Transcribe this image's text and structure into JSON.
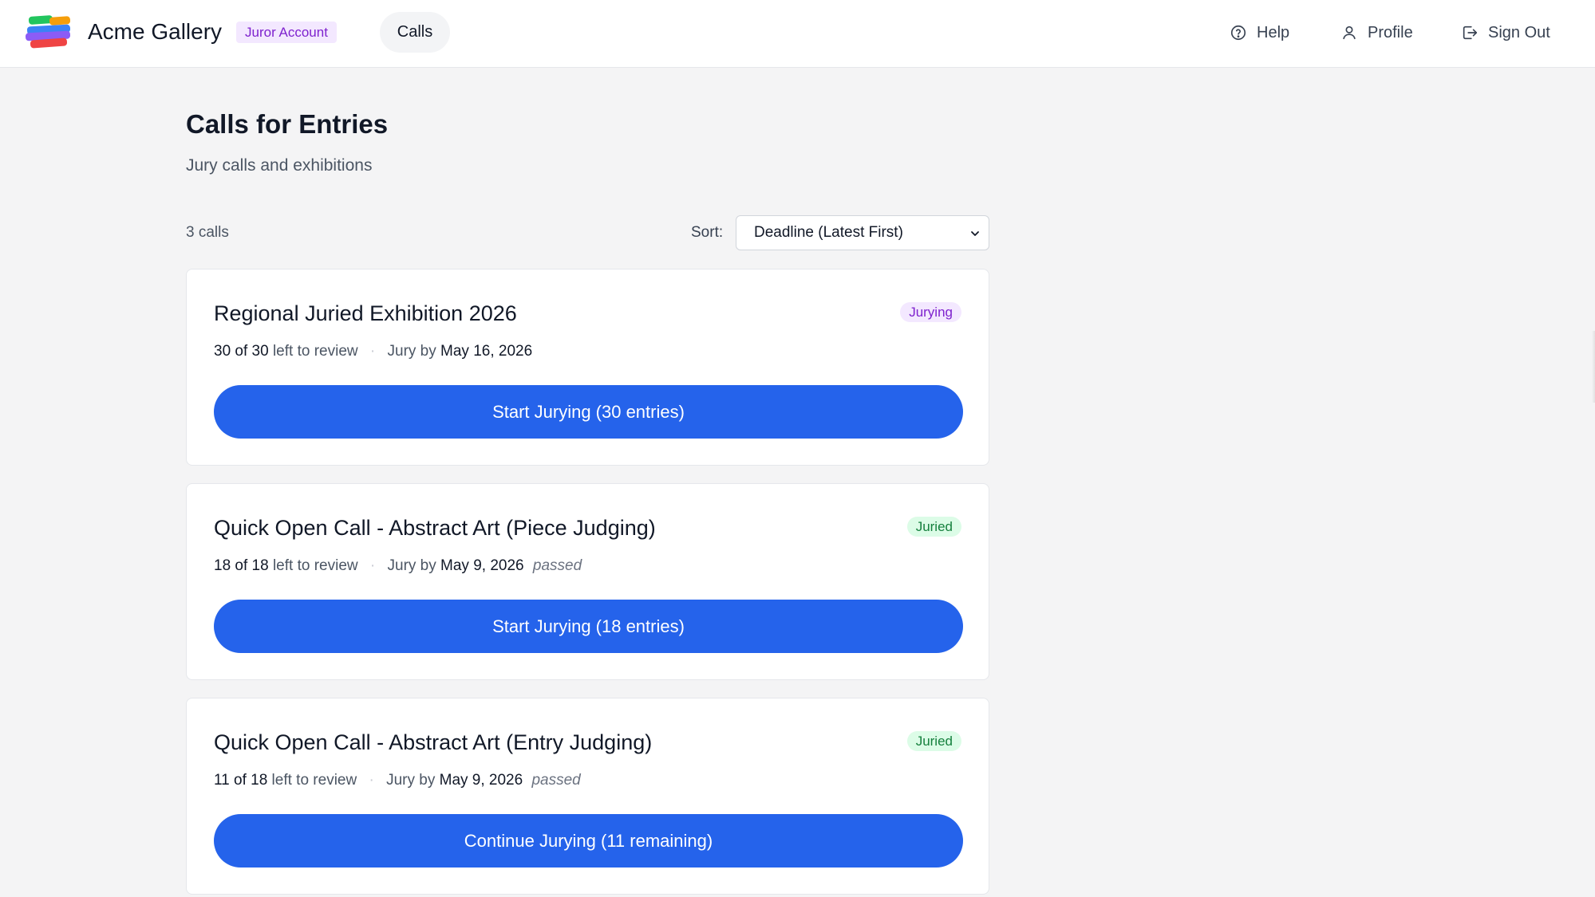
{
  "header": {
    "brand": "Acme Gallery",
    "role_badge": "Juror Account",
    "nav": {
      "calls": "Calls"
    },
    "links": {
      "help": "Help",
      "profile": "Profile",
      "sign_out": "Sign Out"
    }
  },
  "page": {
    "title": "Calls for Entries",
    "subtitle": "Jury calls and exhibitions",
    "count": "3 calls",
    "sort": {
      "label": "Sort:",
      "selected": "Deadline (Latest First)"
    }
  },
  "calls": [
    {
      "title": "Regional Juried Exhibition 2026",
      "status": "Jurying",
      "progress": "30 of 30",
      "left_label": "left to review",
      "jury_by_label": "Jury by",
      "deadline": "May 16, 2026",
      "passed": "",
      "button": "Start Jurying (30 entries)"
    },
    {
      "title": "Quick Open Call - Abstract Art (Piece Judging)",
      "status": "Juried",
      "progress": "18 of 18",
      "left_label": "left to review",
      "jury_by_label": "Jury by",
      "deadline": "May 9, 2026",
      "passed": "passed",
      "button": "Start Jurying (18 entries)"
    },
    {
      "title": "Quick Open Call - Abstract Art (Entry Judging)",
      "status": "Juried",
      "progress": "11 of 18",
      "left_label": "left to review",
      "jury_by_label": "Jury by",
      "deadline": "May 9, 2026",
      "passed": "passed",
      "button": "Continue Jurying (11 remaining)"
    }
  ],
  "colors": {
    "primary": "#2563eb",
    "jurying_badge_bg": "#f3e8ff",
    "jurying_badge_text": "#7e22ce",
    "juried_badge_bg": "#dcfce7",
    "juried_badge_text": "#15803d"
  },
  "icons": {
    "logo": "acme-stacked-stripes-logo",
    "help": "help-circle-icon",
    "profile": "user-icon",
    "sign_out": "sign-out-icon",
    "sort": "chevron-down-icon"
  }
}
